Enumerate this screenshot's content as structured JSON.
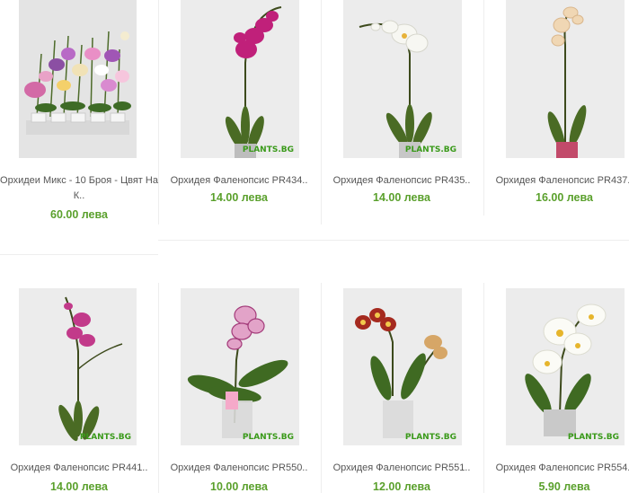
{
  "products": [
    {
      "name_line1": "Орхидеи Микс - 10 Броя - Цвят На",
      "name_line2": "К..",
      "price": "60.00 лева",
      "watermark": ""
    },
    {
      "name_line1": "Орхидея Фаленопсис PR434..",
      "name_line2": "",
      "price": "14.00 лева",
      "watermark": "PLANTS.BG"
    },
    {
      "name_line1": "Орхидея Фаленопсис PR435..",
      "name_line2": "",
      "price": "14.00 лева",
      "watermark": "PLANTS.BG"
    },
    {
      "name_line1": "Орхидея Фаленопсис PR437..",
      "name_line2": "",
      "price": "16.00 лева",
      "watermark": ""
    },
    {
      "name_line1": "Орхидея Фаленопсис PR441..",
      "name_line2": "",
      "price": "14.00 лева",
      "watermark": "PLANTS.BG"
    },
    {
      "name_line1": "Орхидея Фаленопсис PR550..",
      "name_line2": "",
      "price": "10.00 лева",
      "watermark": "PLANTS.BG"
    },
    {
      "name_line1": "Орхидея Фаленопсис PR551..",
      "name_line2": "",
      "price": "12.00 лева",
      "watermark": "PLANTS.BG"
    },
    {
      "name_line1": "Орхидея Фаленопсис PR554..",
      "name_line2": "",
      "price": "5.90 лева",
      "watermark": "PLANTS.BG"
    }
  ],
  "colors": {
    "price": "#5aa02c",
    "watermark": "#3a9a1a",
    "flower_magenta": "#c0207a",
    "flower_white": "#f7f7f2"
  }
}
